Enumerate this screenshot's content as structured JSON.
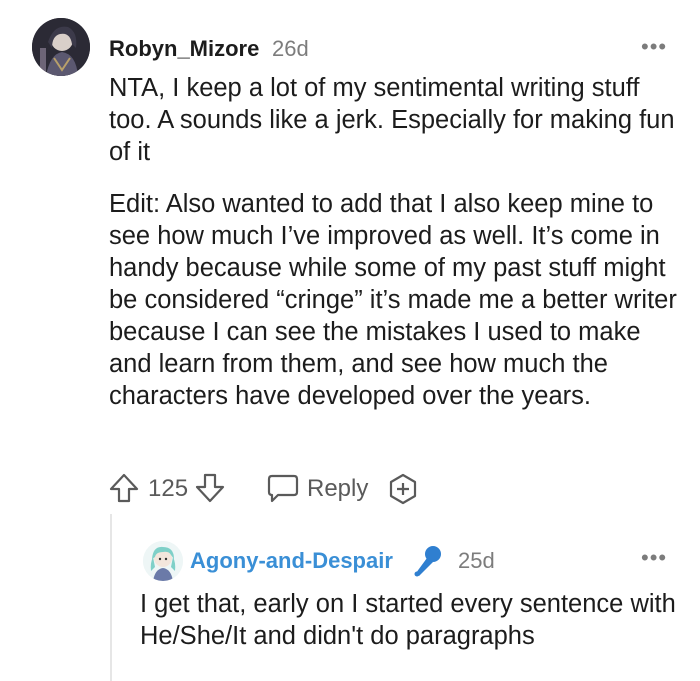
{
  "comment": {
    "author": "Robyn_Mizore",
    "time": "26d",
    "more": "•••",
    "paragraphs": [
      "NTA, I keep a lot of my sentimental writing stuff too. A sounds like a jerk. Especially for making fun of it",
      "Edit: Also wanted to add that I also keep mine to see how much I’ve improved as well. It’s come in handy because while some of my past stuff might be considered “cringe” it’s made me a better writer because I can see the mistakes I used to make and learn from them, and see how much the characters have developed over the years."
    ],
    "actions": {
      "upvote_icon": "arrow-up-icon",
      "votes": "125",
      "downvote_icon": "arrow-down-icon",
      "reply_icon": "speech-bubble-icon",
      "reply": "Reply",
      "award_icon": "award-plus-icon"
    }
  },
  "reply": {
    "author": "Agony-and-Despair",
    "flair_icon": "microphone-icon",
    "time": "25d",
    "more": "•••",
    "text": "I get that, early on I started every sentence with He/She/It and didn't do paragraphs"
  },
  "colors": {
    "username_reply": "#3a8fd6",
    "meta": "#7c7c7c",
    "text": "#1c1c1c"
  }
}
